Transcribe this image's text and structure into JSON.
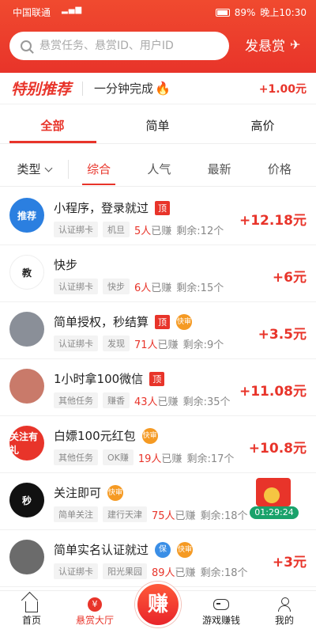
{
  "status_bar": {
    "carrier": "中国联通",
    "battery": "89%",
    "time": "晚上10:30"
  },
  "search": {
    "placeholder": "悬赏任务、悬赏ID、用户ID"
  },
  "post_button": {
    "label": "发悬赏"
  },
  "special": {
    "title": "特别推荐",
    "desc": "一分钟完成",
    "reward": "+1.00元"
  },
  "tabs": [
    {
      "label": "全部",
      "active": true
    },
    {
      "label": "简单"
    },
    {
      "label": "高价"
    }
  ],
  "filters": {
    "type_label": "类型",
    "sorts": [
      {
        "label": "综合",
        "active": true
      },
      {
        "label": "人气"
      },
      {
        "label": "最新"
      },
      {
        "label": "价格"
      }
    ]
  },
  "colors": {
    "accent": "#e8342a",
    "fast_badge": "#f59a23",
    "safe_badge": "#3a8ee6"
  },
  "tasks": [
    {
      "title": "小程序，登录就过",
      "badges": [
        "顶"
      ],
      "tags": [
        "认证绑卡",
        "机旦"
      ],
      "earned_num": "5人",
      "earned_unit": "已赚",
      "remaining": "剩余:12个",
      "reward": "+12.18元",
      "avatar_text": "推荐",
      "avatar_color": "#2b7fe0"
    },
    {
      "title": "快步",
      "badges": [],
      "tags": [
        "认证绑卡",
        "快步"
      ],
      "earned_num": "6人",
      "earned_unit": "已赚",
      "remaining": "剩余:15个",
      "reward": "+6元",
      "avatar_text": "教",
      "avatar_color": "#ffffff"
    },
    {
      "title": "简单授权，秒结算",
      "badges": [
        "顶",
        "快审"
      ],
      "tags": [
        "认证绑卡",
        "发现"
      ],
      "earned_num": "71人",
      "earned_unit": "已赚",
      "remaining": "剩余:9个",
      "reward": "+3.5元",
      "avatar_text": "",
      "avatar_color": "#8a8f98"
    },
    {
      "title": "1小时拿100微信",
      "badges": [
        "顶"
      ],
      "tags": [
        "其他任务",
        "赚香"
      ],
      "earned_num": "43人",
      "earned_unit": "已赚",
      "remaining": "剩余:35个",
      "reward": "+11.08元",
      "avatar_text": "",
      "avatar_color": "#c97a6a"
    },
    {
      "title": "白嫖100元红包",
      "badges": [
        "快审"
      ],
      "tags": [
        "其他任务",
        "OK赚"
      ],
      "earned_num": "19人",
      "earned_unit": "已赚",
      "remaining": "剩余:17个",
      "reward": "+10.8元",
      "avatar_text": "关注有礼",
      "avatar_color": "#e8342a"
    },
    {
      "title": "关注即可",
      "badges": [
        "快审"
      ],
      "tags": [
        "简单关注",
        "建行天津"
      ],
      "earned_num": "75人",
      "earned_unit": "已赚",
      "remaining": "剩余:18个",
      "reward": "",
      "avatar_text": "秒",
      "avatar_color": "#111111"
    },
    {
      "title": "简单实名认证就过",
      "badges": [
        "保",
        "快审"
      ],
      "tags": [
        "认证绑卡",
        "阳光果园"
      ],
      "earned_num": "89人",
      "earned_unit": "已赚",
      "remaining": "剩余:18个",
      "reward": "+3元",
      "avatar_text": "",
      "avatar_color": "#6b6b6b"
    }
  ],
  "float_widget": {
    "timer": "01:29:24"
  },
  "bottom_nav": [
    {
      "label": "首页"
    },
    {
      "label": "悬赏大厅",
      "active": true
    },
    {
      "label": "赚"
    },
    {
      "label": "游戏赚钱"
    },
    {
      "label": "我的"
    }
  ]
}
